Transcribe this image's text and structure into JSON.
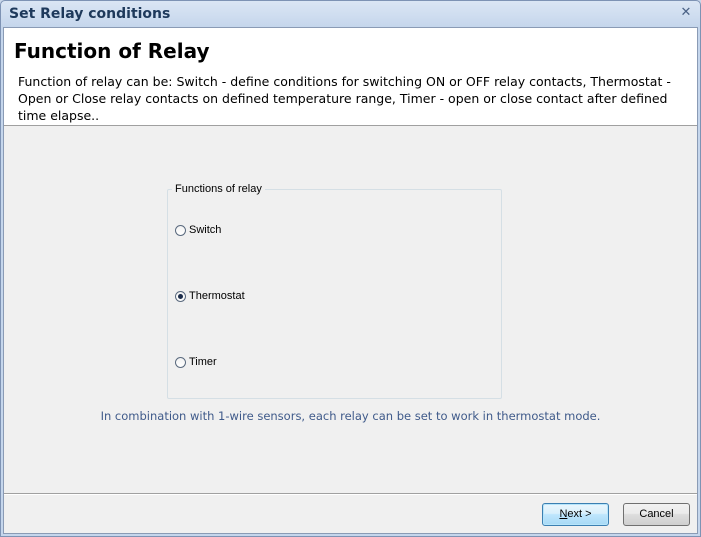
{
  "window": {
    "title": "Set Relay conditions",
    "close_glyph": "✕"
  },
  "header": {
    "title": "Function of Relay",
    "description": "Function of relay can be: Switch - define conditions for switching ON or OFF relay contacts, Thermostat - Open or Close relay contacts on defined temperature range, Timer -  open or close contact after defined time elapse.."
  },
  "group": {
    "legend": "Functions of relay",
    "options": [
      {
        "label": "Switch",
        "checked": false
      },
      {
        "label": "Thermostat",
        "checked": true
      },
      {
        "label": "Timer",
        "checked": false
      }
    ]
  },
  "info_text": "In combination with 1-wire sensors, each relay can be set to work in thermostat mode.",
  "buttons": {
    "next_mnemonic": "N",
    "next_rest": "ext >",
    "cancel": "Cancel"
  },
  "colors": {
    "info_text": "#3f5a8a",
    "title_text": "#1e395b",
    "default_button_border": "#3c7fb1"
  },
  "icons": {
    "close": "close-icon"
  }
}
